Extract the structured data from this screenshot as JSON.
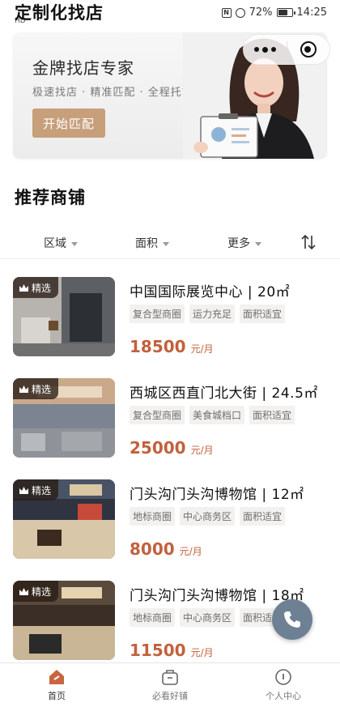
{
  "status_bar": {
    "carrier": "HD",
    "nfc": "N",
    "battery": "72%",
    "battery_level": 0.72,
    "time": "14:25"
  },
  "page_title": "定制化找店",
  "banner": {
    "title": "金牌找店专家",
    "subtitle": "极速找店 · 精准匹配 · 全程托管",
    "button": "开始匹配"
  },
  "section_title": "推荐商铺",
  "filters": [
    {
      "label": "区域"
    },
    {
      "label": "面积"
    },
    {
      "label": "更多"
    }
  ],
  "listings": [
    {
      "badge": "精选",
      "title": "中国国际展览中心 | 20㎡",
      "tags": [
        "复合型商圈",
        "运力充足",
        "面积适宜"
      ],
      "price": "18500",
      "unit": "元/月"
    },
    {
      "badge": "精选",
      "title": "西城区西直门北大街 | 24.5㎡",
      "tags": [
        "复合型商圈",
        "美食城档口",
        "面积适宜"
      ],
      "price": "25000",
      "unit": "元/月"
    },
    {
      "badge": "精选",
      "title": "门头沟门头沟博物馆 | 12㎡",
      "tags": [
        "地标商圈",
        "中心商务区",
        "面积适宜"
      ],
      "price": "8000",
      "unit": "元/月"
    },
    {
      "badge": "精选",
      "title": "门头沟门头沟博物馆 | 18㎡",
      "tags": [
        "地标商圈",
        "中心商务区",
        "面积适宜"
      ],
      "price": "11500",
      "unit": "元/月"
    }
  ],
  "tabbar": [
    {
      "label": "首页",
      "icon": "home-icon",
      "active": true
    },
    {
      "label": "必看好铺",
      "icon": "bag-icon",
      "active": false
    },
    {
      "label": "个人中心",
      "icon": "profile-icon",
      "active": false
    }
  ],
  "colors": {
    "accent": "#c79f7b",
    "price": "#c1613d",
    "tab_active": "#c9643f"
  }
}
